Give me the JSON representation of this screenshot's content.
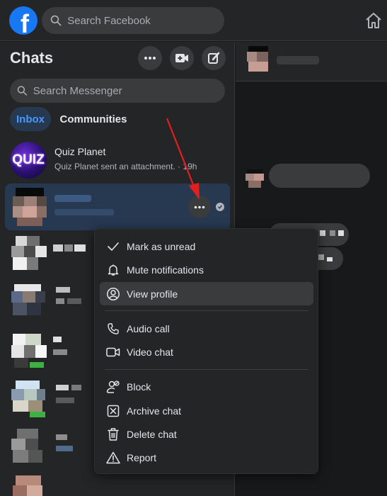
{
  "topbar": {
    "logo_letter": "f",
    "search_placeholder": "Search Facebook"
  },
  "sidebar": {
    "title": "Chats",
    "search_placeholder": "Search Messenger",
    "tabs": [
      {
        "label": "Inbox",
        "active": true
      },
      {
        "label": "Communities",
        "active": false
      }
    ],
    "chats": [
      {
        "name": "Quiz Planet",
        "preview": "Quiz Planet sent an attachment. · 19h",
        "avatar_text": "QUIZ"
      }
    ]
  },
  "context_menu": {
    "items": [
      {
        "label": "Mark as unread",
        "icon": "check-icon"
      },
      {
        "label": "Mute notifications",
        "icon": "bell-icon"
      },
      {
        "label": "View profile",
        "icon": "user-circle-icon",
        "highlighted": true
      },
      {
        "label": "Audio call",
        "icon": "phone-icon"
      },
      {
        "label": "Video chat",
        "icon": "video-icon"
      },
      {
        "label": "Block",
        "icon": "block-user-icon"
      },
      {
        "label": "Archive chat",
        "icon": "archive-icon"
      },
      {
        "label": "Delete chat",
        "icon": "trash-icon"
      },
      {
        "label": "Report",
        "icon": "warning-icon"
      }
    ]
  },
  "colors": {
    "accent": "#1877f2",
    "active_tab_text": "#4599ff",
    "annotation_arrow": "#e41e1e"
  }
}
